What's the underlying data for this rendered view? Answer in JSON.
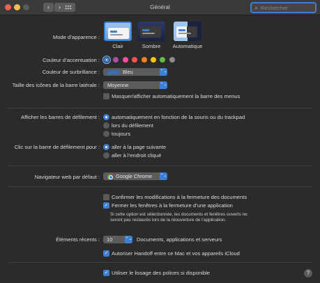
{
  "window": {
    "title": "Général",
    "search_placeholder": "Rechercher",
    "back_glyph": "‹",
    "forward_glyph": "›",
    "search_glyph": "⌕"
  },
  "appearance": {
    "label": "Mode d’apparence :",
    "options": [
      "Clair",
      "Sombre",
      "Automatique"
    ],
    "selected": "Clair"
  },
  "accent": {
    "label": "Couleur d’accentuation :",
    "colors": [
      "#3d7fd1",
      "#a550a7",
      "#f74f9e",
      "#ff5257",
      "#f7821b",
      "#ffc600",
      "#62ba46",
      "#8c8c8c"
    ],
    "selected_index": 0
  },
  "highlight": {
    "label": "Couleur de surbrillance :",
    "value": "Bleu"
  },
  "sidebar_icons": {
    "label": "Taille des icônes de la barre latérale :",
    "value": "Moyenne"
  },
  "menubar": {
    "label": "Masquer/afficher automatiquement la barre des menus",
    "checked": false
  },
  "scrollbars": {
    "label": "Afficher les barres de défilement :",
    "options": [
      "automatiquement en fonction de la souris ou du trackpad",
      "lors du défilement",
      "toujours"
    ],
    "selected_index": 0
  },
  "scroll_click": {
    "label": "Clic sur la barre de défilement pour :",
    "options": [
      "aller à la page suivante",
      "aller à l’endroit cliqué"
    ],
    "selected_index": 0
  },
  "browser": {
    "label": "Navigateur web par défaut :",
    "value": "Google Chrome"
  },
  "documents": {
    "confirm_label": "Confirmer les modifications à la fermeture des documents",
    "confirm_checked": false,
    "close_windows_label": "Fermer les fenêtres à la fermeture d’une application",
    "close_windows_checked": true,
    "note": "Si cette option est sélectionnée, les documents et fenêtres ouverts ne seront pas restaurés lors de la réouverture de l’application."
  },
  "recent": {
    "label": "Éléments récents :",
    "value": "10",
    "suffix": "Documents, applications et serveurs"
  },
  "handoff": {
    "label": "Autoriser Handoff entre ce Mac et vos appareils iCloud",
    "checked": true
  },
  "font_smoothing": {
    "label": "Utiliser le lissage des polices si disponible",
    "checked": true
  },
  "help_glyph": "?",
  "check_glyph": "✓",
  "popup_arrows": "⌃⌄"
}
